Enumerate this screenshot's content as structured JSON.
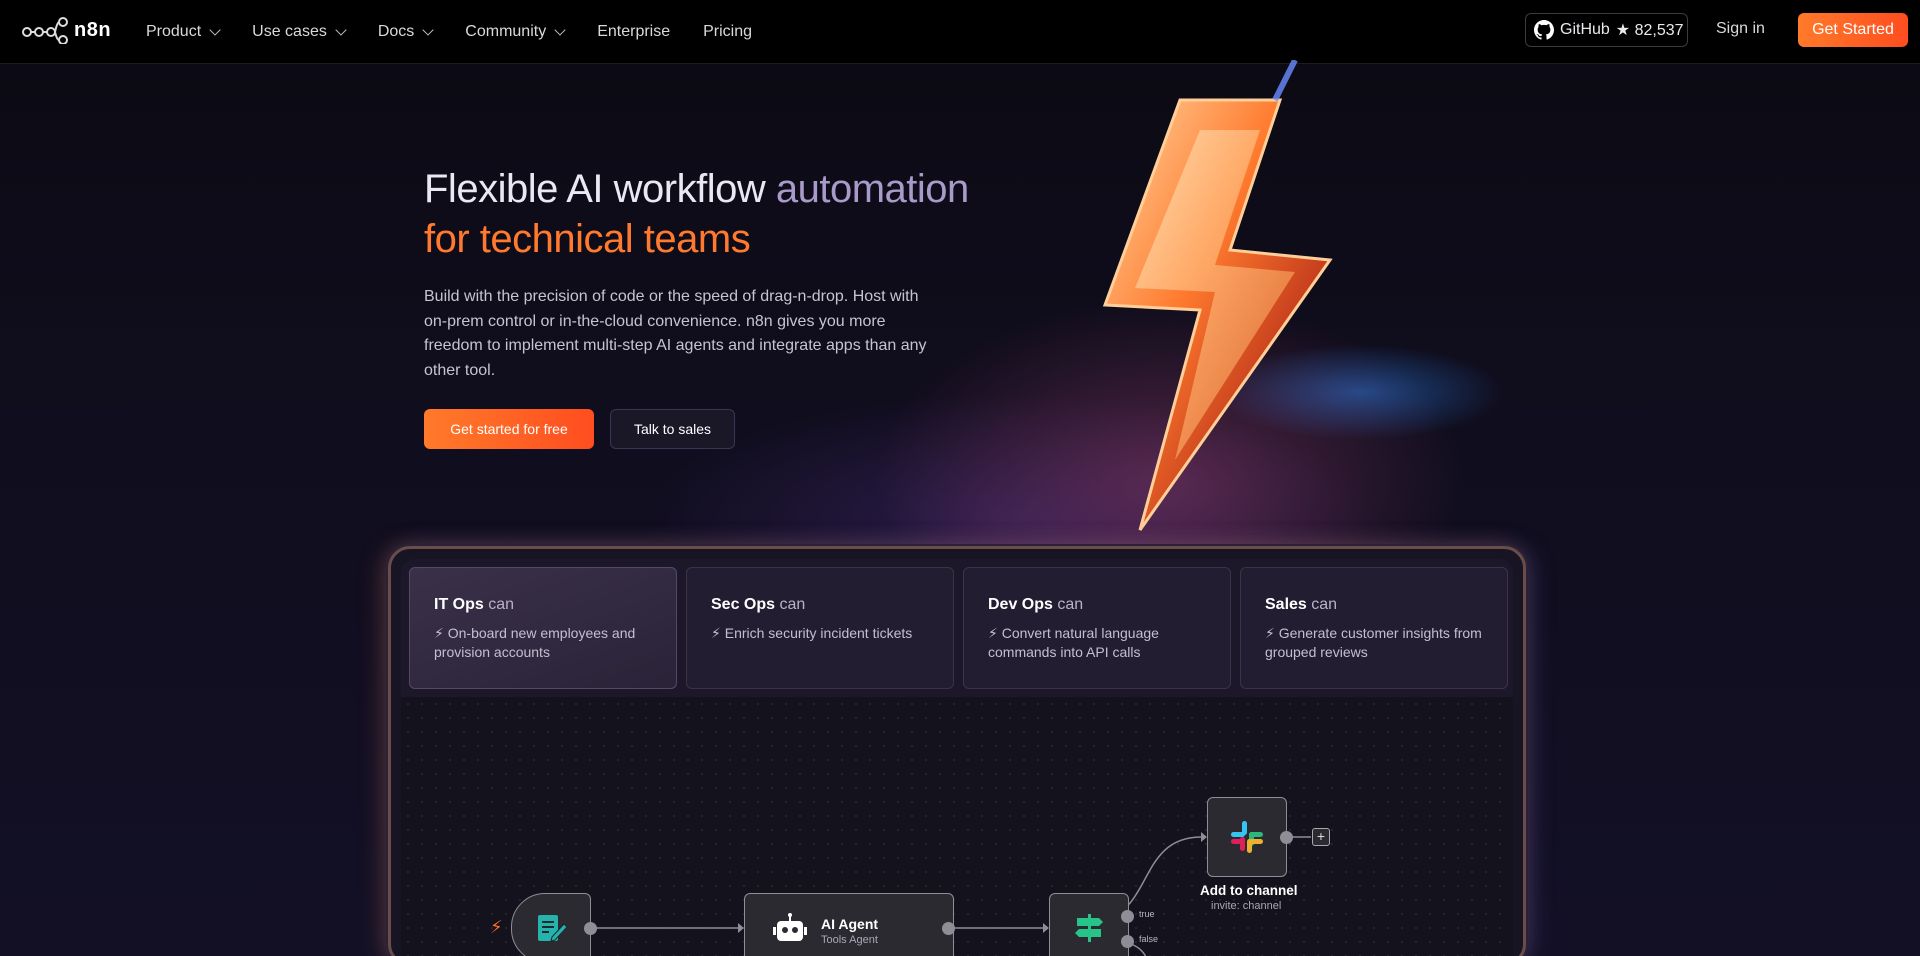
{
  "nav": {
    "logo_text": "n8n",
    "links": [
      {
        "label": "Product",
        "dropdown": true
      },
      {
        "label": "Use cases",
        "dropdown": true
      },
      {
        "label": "Docs",
        "dropdown": true
      },
      {
        "label": "Community",
        "dropdown": true
      },
      {
        "label": "Enterprise",
        "dropdown": false
      },
      {
        "label": "Pricing",
        "dropdown": false
      }
    ],
    "github_label": "GitHub",
    "github_stars": "★ 82,537",
    "signin_label": "Sign in",
    "get_started_label": "Get Started"
  },
  "hero": {
    "title_part1": "Flexible AI workflow ",
    "title_part2": "automation",
    "title_part3": "for technical teams",
    "description": "Build with the precision of code or the speed of drag-n-drop. Host with on-prem control or in-the-cloud convenience. n8n gives you more freedom to implement multi-step AI agents and integrate apps than any other tool.",
    "cta_primary": "Get started for free",
    "cta_secondary": "Talk to sales"
  },
  "tabs": [
    {
      "team": "IT Ops",
      "can": "can",
      "desc": "On-board new employees and provision accounts",
      "active": true
    },
    {
      "team": "Sec Ops",
      "can": "can",
      "desc": "Enrich security incident tickets",
      "active": false
    },
    {
      "team": "Dev Ops",
      "can": "can",
      "desc": "Convert natural language commands into API calls",
      "active": false
    },
    {
      "team": "Sales",
      "can": "can",
      "desc": "Generate customer insights from grouped reviews",
      "active": false
    }
  ],
  "workflow": {
    "agent_label": "AI Agent",
    "agent_sub": "Tools Agent",
    "slack_label": "Add to channel",
    "slack_sub": "invite: channel",
    "true_label": "true",
    "false_label": "false",
    "plus": "+"
  },
  "colors": {
    "accent": "#ff6a24",
    "title_muted": "#a99bc9"
  }
}
